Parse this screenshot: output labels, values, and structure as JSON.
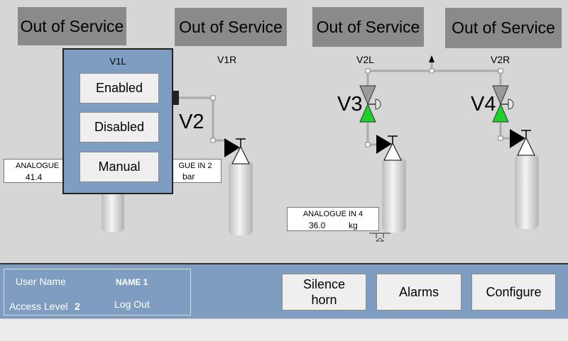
{
  "out_of_service_labels": [
    "Out of Service",
    "Out of Service",
    "Out of Service",
    "Out of Service"
  ],
  "valve_tags": {
    "v1r": "V1R",
    "v2l": "V2L",
    "v2r": "V2R"
  },
  "valve_names": {
    "v2": "V2",
    "v3": "V3",
    "v4": "V4"
  },
  "popup": {
    "title": "V1L",
    "enabled_label": "Enabled",
    "disabled_label": "Disabled",
    "manual_label": "Manual"
  },
  "analogue_1": {
    "title": "ANALOGUE",
    "value": "41.4"
  },
  "analogue_2": {
    "title": "GUE IN 2",
    "unit": "bar"
  },
  "analogue_4": {
    "title": "ANALOGUE IN 4",
    "value": "36.0",
    "unit": "kg"
  },
  "user_panel": {
    "user_name_label": "User Name",
    "user_name_value": "NAME 1",
    "access_level_label": "Access Level",
    "access_level_value": "2",
    "logout_label": "Log Out"
  },
  "buttons": {
    "silence_line1": "Silence",
    "silence_line2": "horn",
    "alarms": "Alarms",
    "configure": "Configure"
  },
  "colors": {
    "panel_blue": "#7f9dc0",
    "valve_open_green": "#1ed22a",
    "out_of_service_gray": "#8a8a8a"
  }
}
